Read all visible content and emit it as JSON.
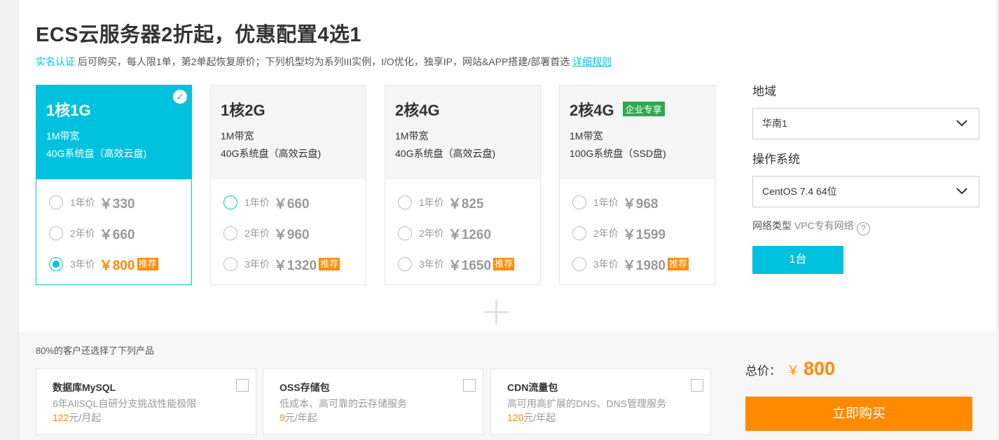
{
  "title": "ECS云服务器2折起，优惠配置4选1",
  "subline": {
    "verify_link": "实名认证",
    "text": " 后可购买，每人限1单，第2单起恢复原价；下列机型均为系列III实例，I/O优化，独享IP，网站&APP搭建/部署首选 ",
    "rules_link": "详细规则"
  },
  "cards": [
    {
      "name": "1核1G",
      "badge": "",
      "bandwidth": "1M带宽",
      "disk": "40G系统盘（高效云盘)",
      "selected": true,
      "prices": [
        {
          "label": "1年价",
          "value": "￥330",
          "recommend": "",
          "state": "none"
        },
        {
          "label": "2年价",
          "value": "￥660",
          "recommend": "",
          "state": "none"
        },
        {
          "label": "3年价",
          "value": "￥800",
          "recommend": "推荐",
          "state": "checked"
        }
      ]
    },
    {
      "name": "1核2G",
      "badge": "",
      "bandwidth": "1M带宽",
      "disk": "40G系统盘（高效云盘)",
      "selected": false,
      "prices": [
        {
          "label": "1年价",
          "value": "￥660",
          "recommend": "",
          "state": "active"
        },
        {
          "label": "2年价",
          "value": "￥960",
          "recommend": "",
          "state": "none"
        },
        {
          "label": "3年价",
          "value": "￥1320",
          "recommend": "推荐",
          "state": "none"
        }
      ]
    },
    {
      "name": "2核4G",
      "badge": "",
      "bandwidth": "1M带宽",
      "disk": "40G系统盘（高效云盘)",
      "selected": false,
      "prices": [
        {
          "label": "1年价",
          "value": "￥825",
          "recommend": "",
          "state": "none"
        },
        {
          "label": "2年价",
          "value": "￥1260",
          "recommend": "",
          "state": "none"
        },
        {
          "label": "3年价",
          "value": "￥1650",
          "recommend": "推荐",
          "state": "none"
        }
      ]
    },
    {
      "name": "2核4G",
      "badge": "企业专享",
      "bandwidth": "1M带宽",
      "disk": "100G系统盘（SSD盘)",
      "selected": false,
      "prices": [
        {
          "label": "1年价",
          "value": "￥968",
          "recommend": "",
          "state": "none"
        },
        {
          "label": "2年价",
          "value": "￥1599",
          "recommend": "",
          "state": "none"
        },
        {
          "label": "3年价",
          "value": "￥1980",
          "recommend": "推荐",
          "state": "none"
        }
      ]
    }
  ],
  "region": {
    "label": "地域",
    "value": "华南1"
  },
  "os": {
    "label": "操作系统",
    "value": "CentOS 7.4 64位"
  },
  "network": {
    "label": "网络类型",
    "value": " VPC专有网络",
    "help": "?"
  },
  "quantity": "1台",
  "also_bought": "80%的客户还选择了下列产品",
  "products": [
    {
      "name": "数据库MySQL",
      "desc": "6年AliSQL自研分支挑战性能极限",
      "price": "122",
      "unit": "元/月起"
    },
    {
      "name": "OSS存储包",
      "desc": "低成本、高可靠的云存储服务",
      "price": "9",
      "unit": "元/年起"
    },
    {
      "name": "CDN流量包",
      "desc": "高可用高扩展的DNS、DNS管理服务",
      "price": "120",
      "unit": "元/年起"
    }
  ],
  "total": {
    "label": "总价：",
    "currency": "￥",
    "amount": "800"
  },
  "buy_label": "立即购买",
  "colors": {
    "accent": "#00c1de",
    "orange": "#ff8a00",
    "enterprise_green": "#2fa84f"
  },
  "icons": {
    "selected": "check-circle-icon",
    "dropdown": "chevron-down-icon",
    "help": "help-circle-icon",
    "add": "plus-icon"
  }
}
